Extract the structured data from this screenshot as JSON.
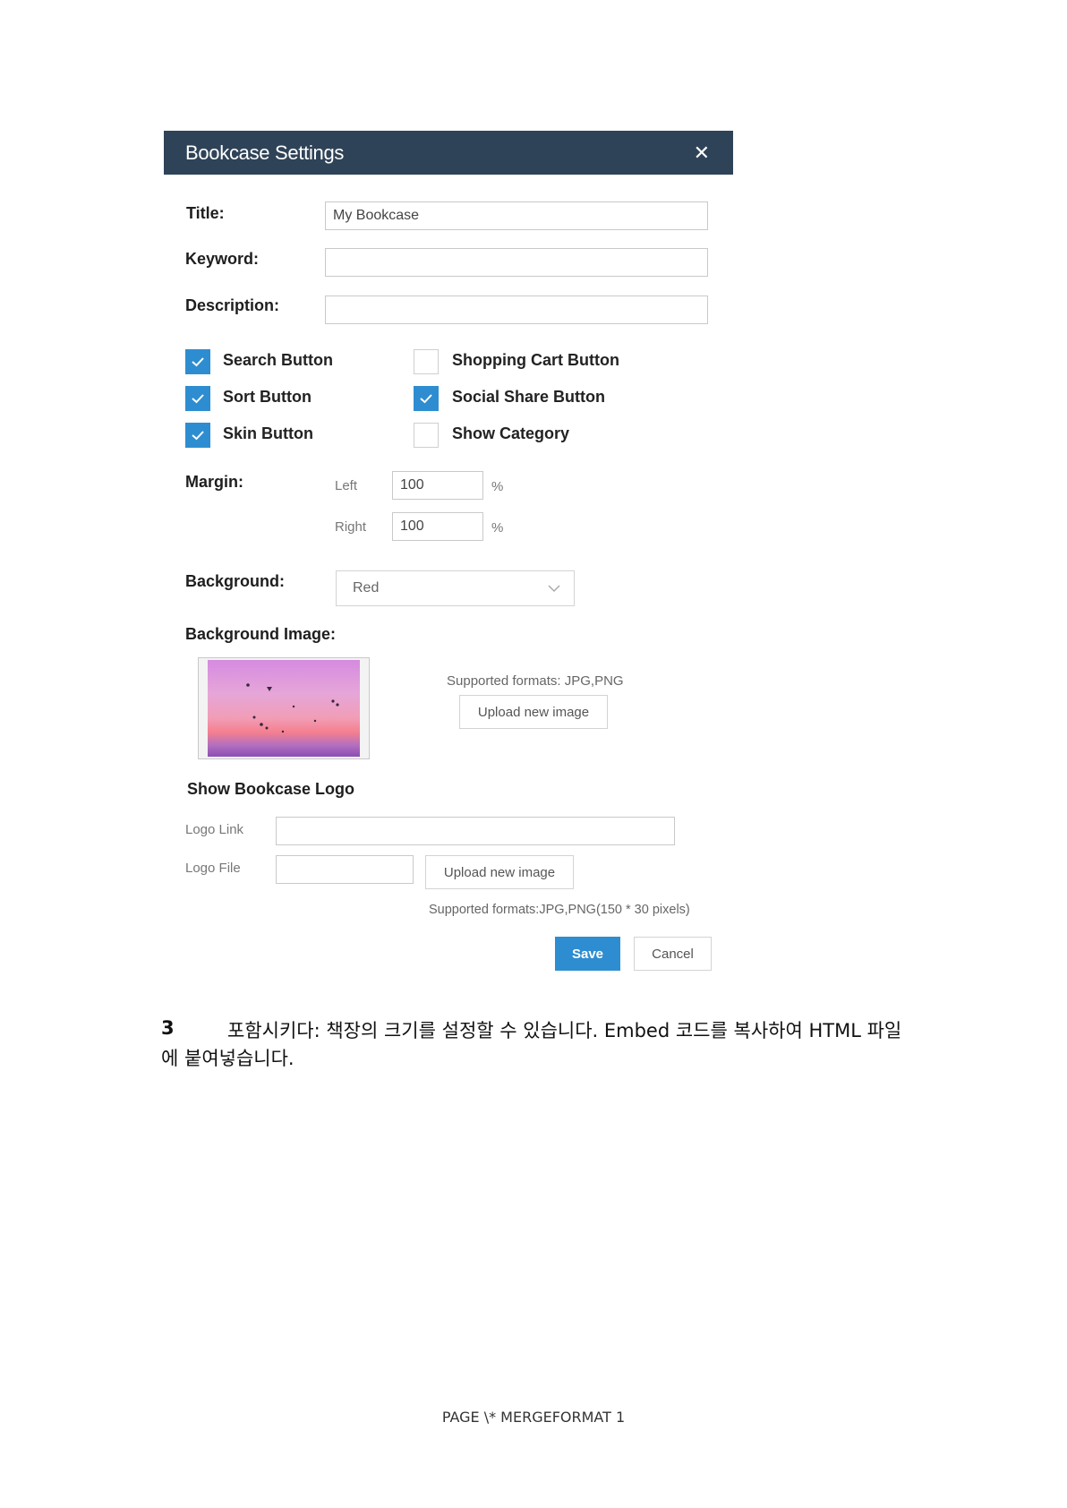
{
  "dialog": {
    "title": "Bookcase Settings",
    "close_glyph": "✕",
    "fields": {
      "title_label": "Title:",
      "title_value": "My Bookcase",
      "keyword_label": "Keyword:",
      "keyword_value": "",
      "description_label": "Description:",
      "description_value": ""
    },
    "checkboxes": [
      {
        "label": "Search Button",
        "checked": true
      },
      {
        "label": "Sort Button",
        "checked": true
      },
      {
        "label": "Skin Button",
        "checked": true
      },
      {
        "label": "Shopping Cart Button",
        "checked": false
      },
      {
        "label": "Social Share Button",
        "checked": true
      },
      {
        "label": "Show Category",
        "checked": false
      }
    ],
    "margin": {
      "label": "Margin:",
      "left_label": "Left",
      "left_value": "100",
      "right_label": "Right",
      "right_value": "100",
      "unit": "%"
    },
    "background": {
      "label": "Background:",
      "selected": "Red",
      "chevron_icon": "chevron-down-icon"
    },
    "background_image": {
      "label": "Background Image:",
      "formats": "Supported formats: JPG,PNG",
      "upload_label": "Upload new image"
    },
    "logo": {
      "heading": "Show Bookcase Logo",
      "link_label": "Logo Link",
      "link_value": "",
      "file_label": "Logo File",
      "file_value": "",
      "upload_label": "Upload new image",
      "formats": "Supported formats:JPG,PNG(150 * 30 pixels)"
    },
    "actions": {
      "save_label": "Save",
      "cancel_label": "Cancel"
    },
    "colors": {
      "header_bg": "#2f4358",
      "accent": "#2e8dd0"
    }
  },
  "document": {
    "step_number": "3",
    "step_text": "포함시키다: 책장의 크기를 설정할 수 있습니다. Embed 코드를 복사하여 HTML 파일에 붙여넣습니다.",
    "footer": "PAGE \\* MERGEFORMAT 1"
  }
}
